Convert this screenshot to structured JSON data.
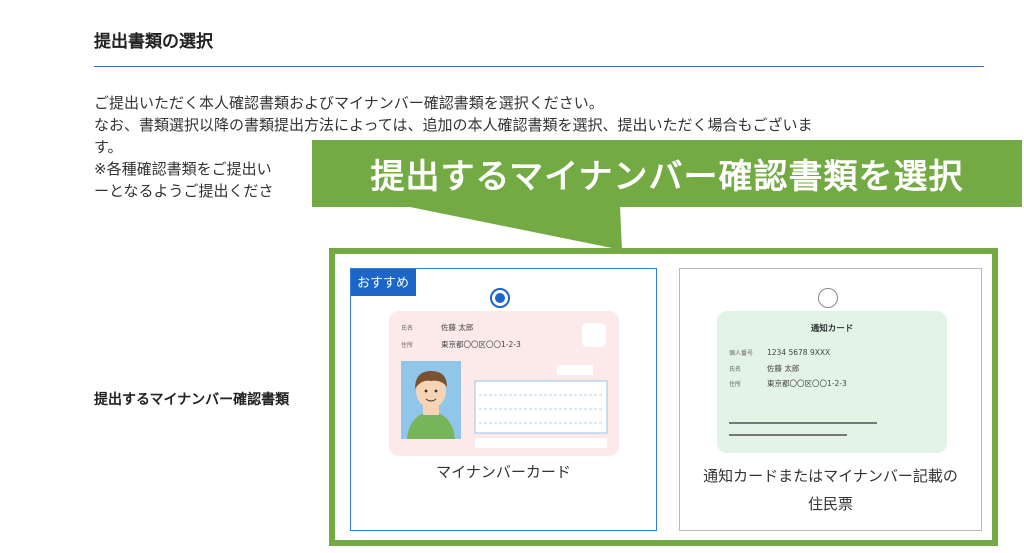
{
  "section": {
    "title": "提出書類の選択"
  },
  "intro": {
    "line1": "ご提出いただく本人確認書類およびマイナンバー確認書類を選択ください。",
    "line2": "なお、書類選択以降の書類提出方法によっては、追加の本人確認書類を選択、提出いただく場合もございま",
    "line3": "す。",
    "line4": "※各種確認書類をご提出い",
    "line5": "ーとなるようご提出くださ"
  },
  "banner": {
    "text": "提出するマイナンバー確認書類を選択",
    "color": "#73aa43"
  },
  "form": {
    "row_label": "提出するマイナンバー確認書類"
  },
  "options": [
    {
      "badge": "おすすめ",
      "label": "マイナンバーカード",
      "selected": true,
      "card": {
        "name_key": "氏名",
        "name": "佐藤 太郎",
        "address_key": "住所",
        "address": "東京都〇〇区〇〇1-2-3"
      }
    },
    {
      "label_line1": "通知カードまたはマイナンバー記載の",
      "label_line2": "住民票",
      "selected": false,
      "card": {
        "title": "通知カード",
        "number_key": "個人番号",
        "number": "1234 5678 9XXX",
        "name_key": "氏名",
        "name": "佐藤 太郎",
        "address_key": "住所",
        "address": "東京都〇〇区〇〇1-2-3"
      }
    }
  ],
  "colors": {
    "accent": "#1c66c9",
    "highlight": "#73aa43",
    "card_pink": "#fce9e9",
    "card_green": "#e3f3e6"
  }
}
